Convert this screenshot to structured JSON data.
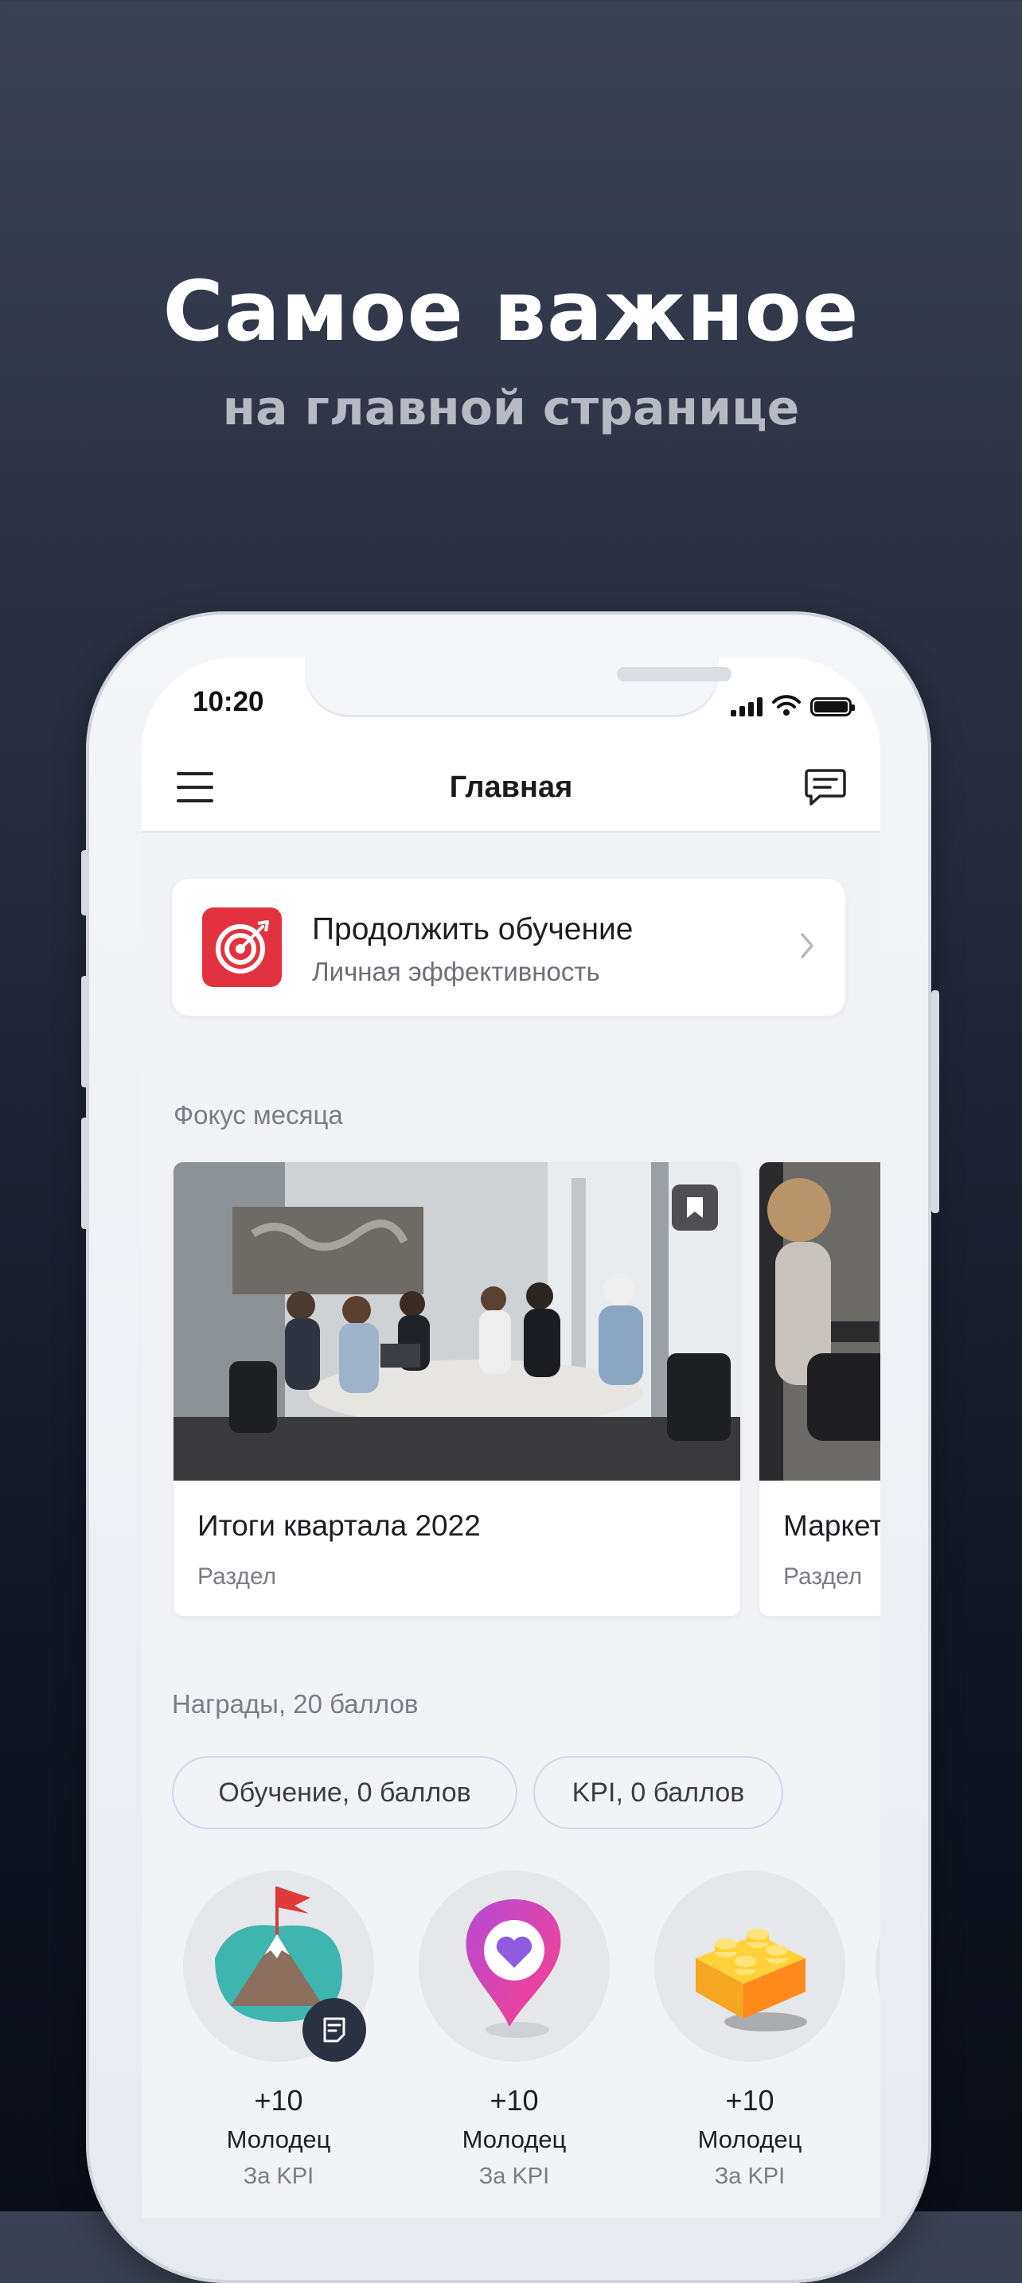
{
  "promo": {
    "headline": "Самое важное",
    "subheadline": "на главной странице"
  },
  "status_bar": {
    "time": "10:20"
  },
  "header": {
    "title": "Главная"
  },
  "continue_learning": {
    "title": "Продолжить обучение",
    "subtitle": "Личная эффективность"
  },
  "focus": {
    "section_title": "Фокус месяца",
    "cards": [
      {
        "title": "Итоги квартала 2022",
        "subtitle": "Раздел"
      },
      {
        "title": "Маркет",
        "subtitle": "Раздел"
      }
    ]
  },
  "awards": {
    "section_title": "Награды, 20 баллов",
    "chips": [
      {
        "label": "Обучение, 0 баллов"
      },
      {
        "label": "KPI, 0 баллов"
      }
    ],
    "items": [
      {
        "points": "+10",
        "name": "Молодец",
        "reason": "За KPI",
        "icon": "mountain-flag-icon"
      },
      {
        "points": "+10",
        "name": "Молодец",
        "reason": "За KPI",
        "icon": "heart-pin-icon"
      },
      {
        "points": "+10",
        "name": "Молодец",
        "reason": "За KPI",
        "icon": "lego-brick-icon"
      }
    ]
  },
  "colors": {
    "accent_red": "#e3323f",
    "chip_border": "#d2d7ea",
    "background_top": "#3b4253",
    "background_bottom": "#0a0d17"
  }
}
